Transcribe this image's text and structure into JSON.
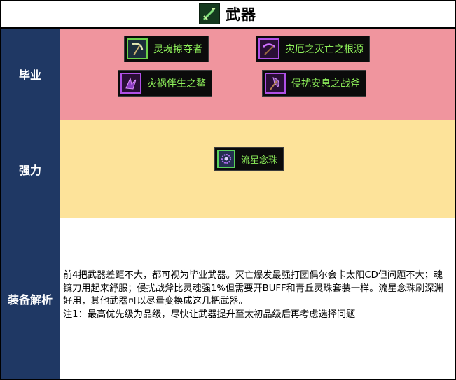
{
  "header": {
    "title": "武器",
    "icon": "sword-icon"
  },
  "rows": [
    {
      "label": "毕业",
      "items": [
        {
          "name": "灵魂掠夺者",
          "icon": "scythe-icon"
        },
        {
          "name": "灾厄之灭亡之根源",
          "icon": "chain-scythe-icon"
        },
        {
          "name": "灾祸伴生之鳌",
          "icon": "claw-blade-icon"
        },
        {
          "name": "侵扰安息之战斧",
          "icon": "battle-axe-icon"
        }
      ]
    },
    {
      "label": "强力",
      "items": [
        {
          "name": "流星念珠",
          "icon": "rosary-icon"
        }
      ]
    },
    {
      "label": "装备解析",
      "text": [
        "前4把武器差距不大，都可视为毕业武器。灭亡爆发最强打团偶尔会卡太阳CD但问题不大；魂镰刀用起来舒服；侵扰战斧比灵魂强1%但需要开BUFF和青丘灵珠套装一样。流星念珠刷深渊好用，其他武器可以尽量变换成这几把武器。",
        "注1：最高优先级为品级，尽快让武器提升至太初品级后再考虑选择问题"
      ]
    }
  ],
  "colors": {
    "label_bg": "#1f3864",
    "graduation_bg": "#f0959e",
    "strong_bg": "#fde39a",
    "item_text": "#8ef05a"
  }
}
